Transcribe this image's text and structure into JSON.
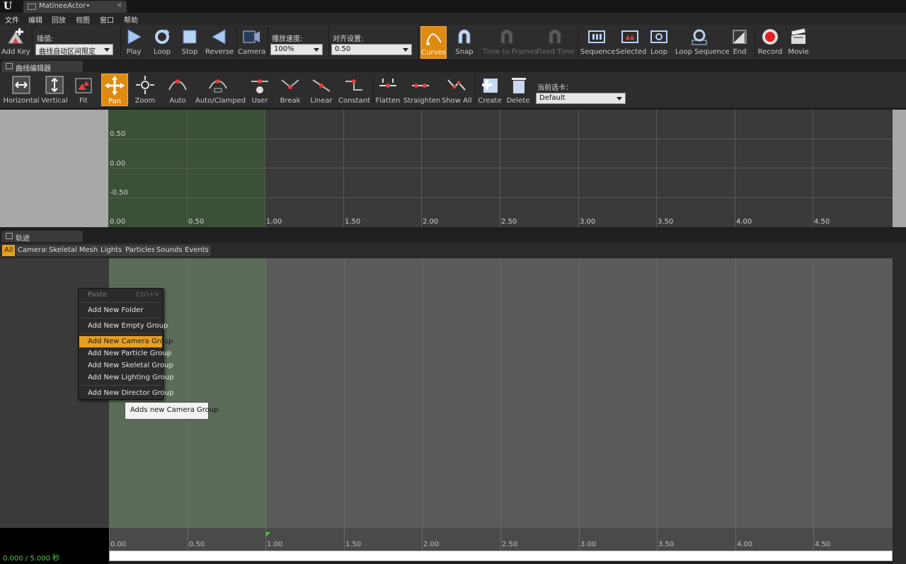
{
  "titlebar": {
    "logo": "U",
    "tab_title": "MatineeActor•",
    "tab_close": "×"
  },
  "menubar": {
    "items": [
      "文件",
      "编辑",
      "回放",
      "视图",
      "窗口",
      "帮助"
    ]
  },
  "toolbar": {
    "add_key": "Add Key",
    "interp_caption": "插值:",
    "interp_value": "曲线自动区间限定",
    "play": "Play",
    "loop": "Loop",
    "stop": "Stop",
    "reverse": "Reverse",
    "camera": "Camera",
    "speed_caption": "播放速度:",
    "speed_value": "100%",
    "snap_caption": "对齐设置:",
    "snap_value": "0.50",
    "curves": "Curves",
    "snap": "Snap",
    "time_to_frames": "Time to Frames",
    "fixed_time": "Fixed Time",
    "sequence": "Sequence",
    "selected": "Selected",
    "loop2": "Loop",
    "loop_sequence": "Loop Sequence",
    "end": "End",
    "record": "Record",
    "movie": "Movie"
  },
  "curve_panel": {
    "tab_label": "曲线编辑器"
  },
  "curvebar": {
    "horizontal": "Horizontal",
    "vertical": "Vertical",
    "fit": "Fit",
    "pan": "Pan",
    "zoom": "Zoom",
    "auto": "Auto",
    "auto_clamped": "Auto/Clamped",
    "user": "User",
    "break": "Break",
    "linear": "Linear",
    "constant": "Constant",
    "flatten": "Flatten",
    "straighten": "Straighten",
    "show_all": "Show All",
    "create": "Create",
    "delete": "Delete",
    "current_tab_caption": "当前选卡：",
    "current_tab_value": "Default"
  },
  "curve_graph": {
    "y_labels": [
      "0.50",
      "0.00",
      "-0.50"
    ],
    "x_labels": [
      "0.00",
      "0.50",
      "1.00",
      "1.50",
      "2.00",
      "2.50",
      "3.00",
      "3.50",
      "4.00",
      "4.50"
    ]
  },
  "tracks_panel": {
    "tab_label": "轨迹"
  },
  "filters": [
    "All",
    "Cameras",
    "Skeletal Meshes",
    "Lights",
    "Particles",
    "Sounds",
    "Events"
  ],
  "context_menu": {
    "paste": "Paste",
    "paste_shortcut": "Ctrl+V",
    "add_new_folder": "Add New Folder",
    "add_new_empty_group": "Add New Empty Group",
    "add_new_camera_group": "Add New Camera Group",
    "add_new_particle_group": "Add New Particle Group",
    "add_new_skeletal_group": "Add New Skeletal Group",
    "add_new_lighting_group": "Add New Lighting Group",
    "add_new_director_group": "Add New Director Group"
  },
  "tooltip": "Adds new Camera Group",
  "timeline": {
    "readout": "0.000 / 5.000 秒",
    "x_labels": [
      "0.00",
      "0.50",
      "1.00",
      "1.50",
      "2.00",
      "2.50",
      "3.00",
      "3.50",
      "4.00",
      "4.50"
    ]
  },
  "colors": {
    "accent": "#e8a020",
    "highlight_region": "#3c5038",
    "time_green": "#4ccf40"
  }
}
